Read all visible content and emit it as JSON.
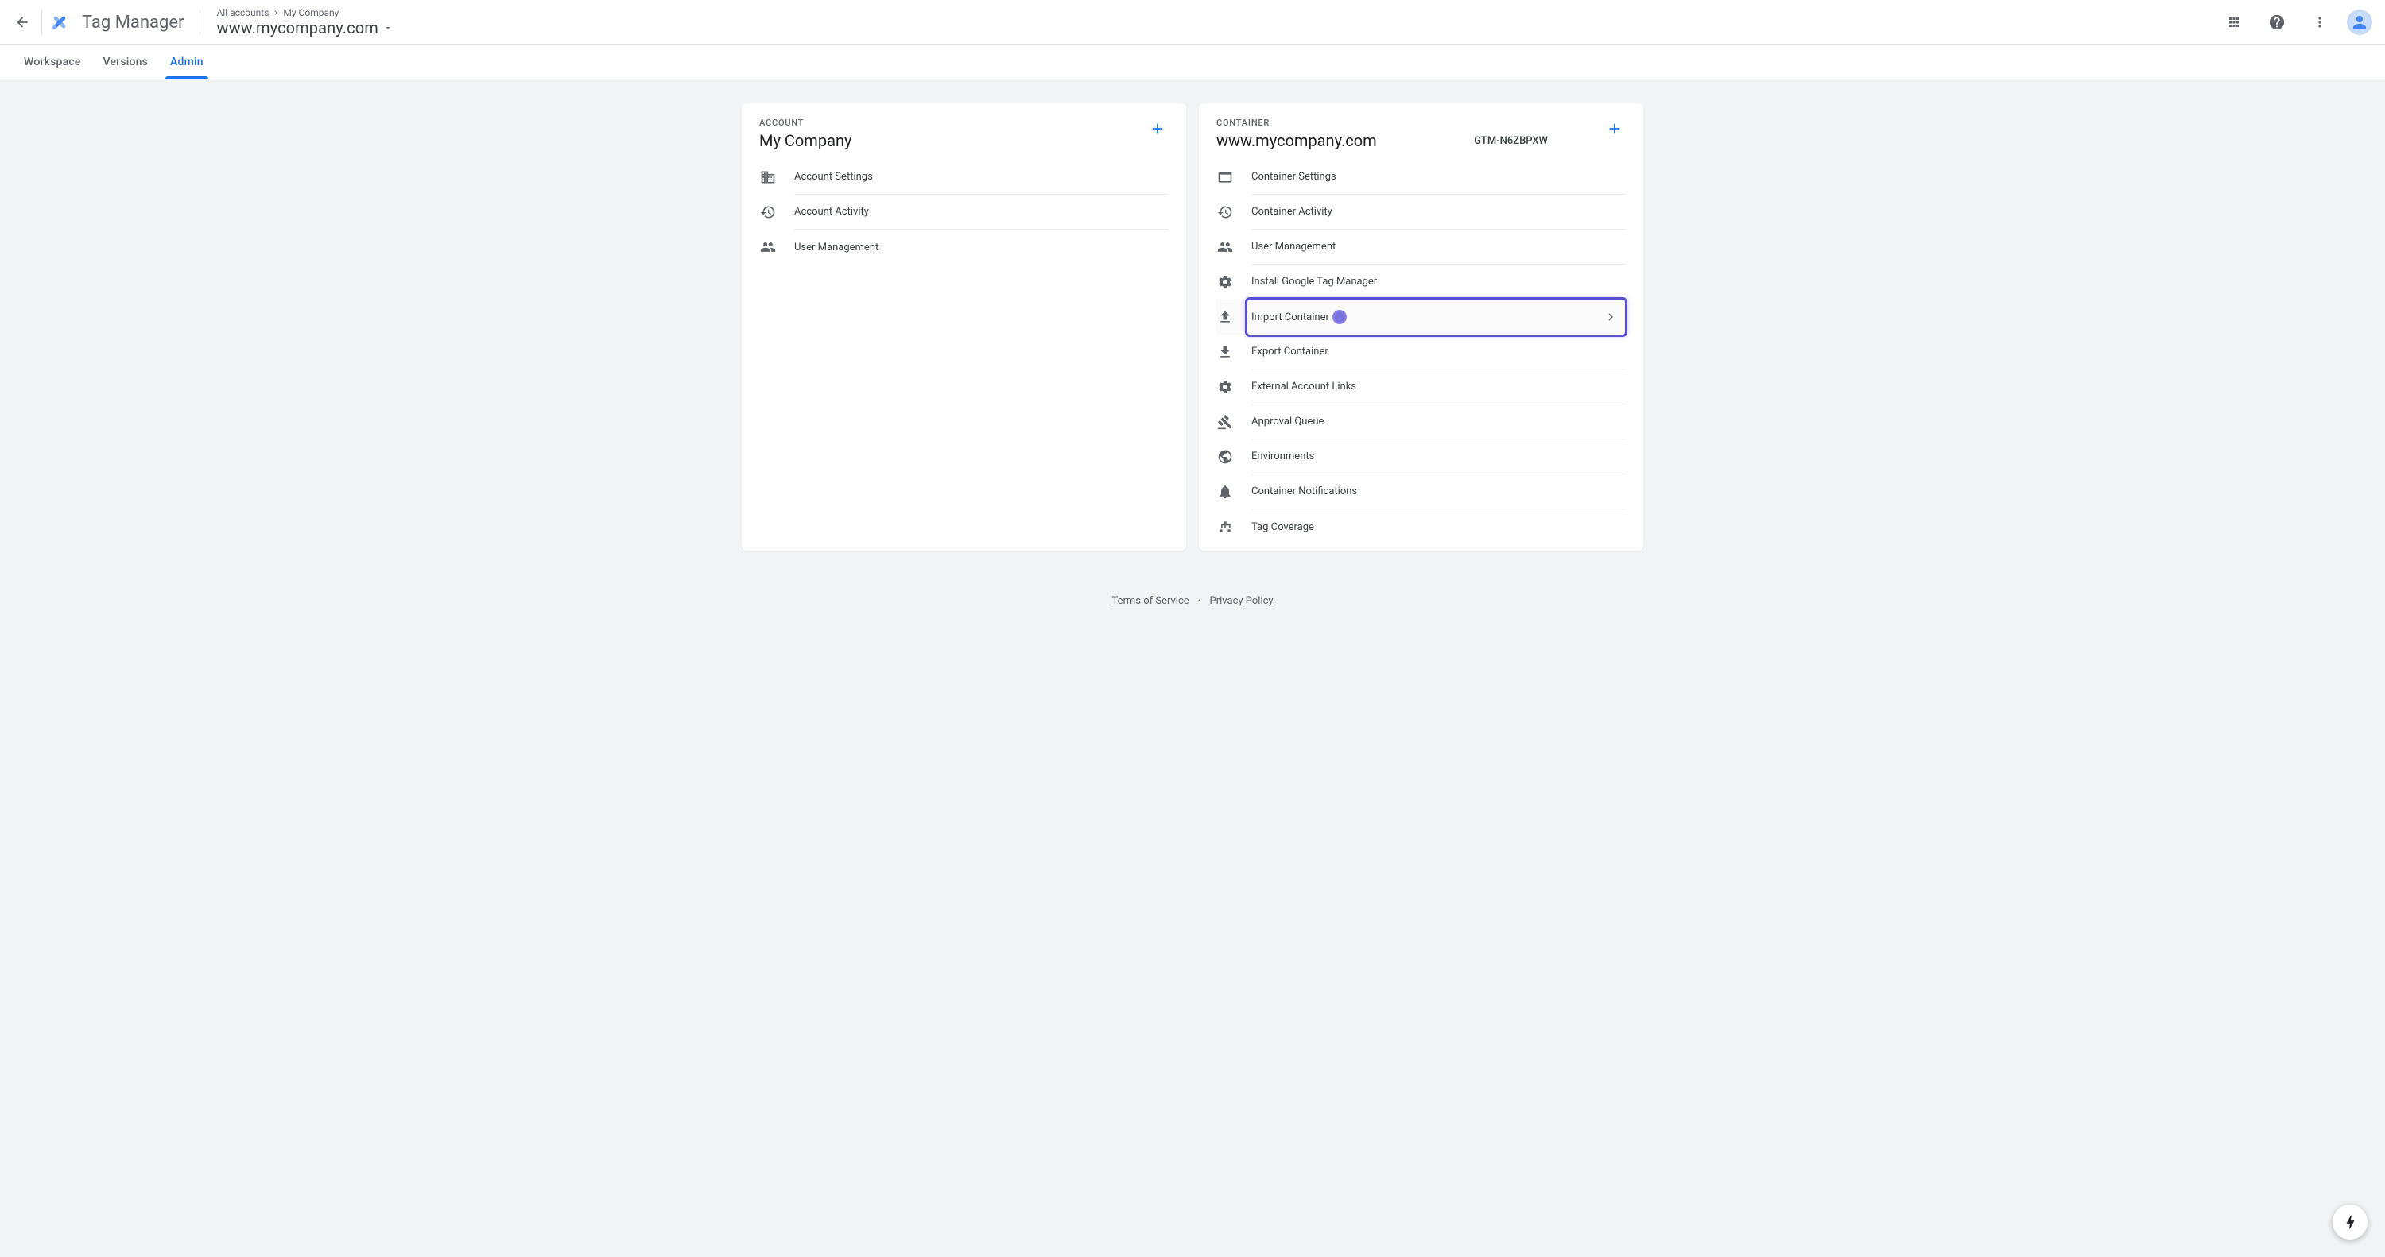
{
  "header": {
    "product": "Tag Manager",
    "breadcrumb": [
      "All accounts",
      "My Company"
    ],
    "container": "www.mycompany.com"
  },
  "tabs": {
    "workspace": "Workspace",
    "versions": "Versions",
    "admin": "Admin"
  },
  "account_card": {
    "label": "Account",
    "title": "My Company",
    "items": [
      "Account Settings",
      "Account Activity",
      "User Management"
    ]
  },
  "container_card": {
    "label": "Container",
    "title": "www.mycompany.com",
    "id": "GTM-N6ZBPXW",
    "items": [
      "Container Settings",
      "Container Activity",
      "User Management",
      "Install Google Tag Manager",
      "Import Container",
      "Export Container",
      "External Account Links",
      "Approval Queue",
      "Environments",
      "Container Notifications",
      "Tag Coverage"
    ]
  },
  "footer": {
    "tos": "Terms of Service",
    "privacy": "Privacy Policy"
  }
}
